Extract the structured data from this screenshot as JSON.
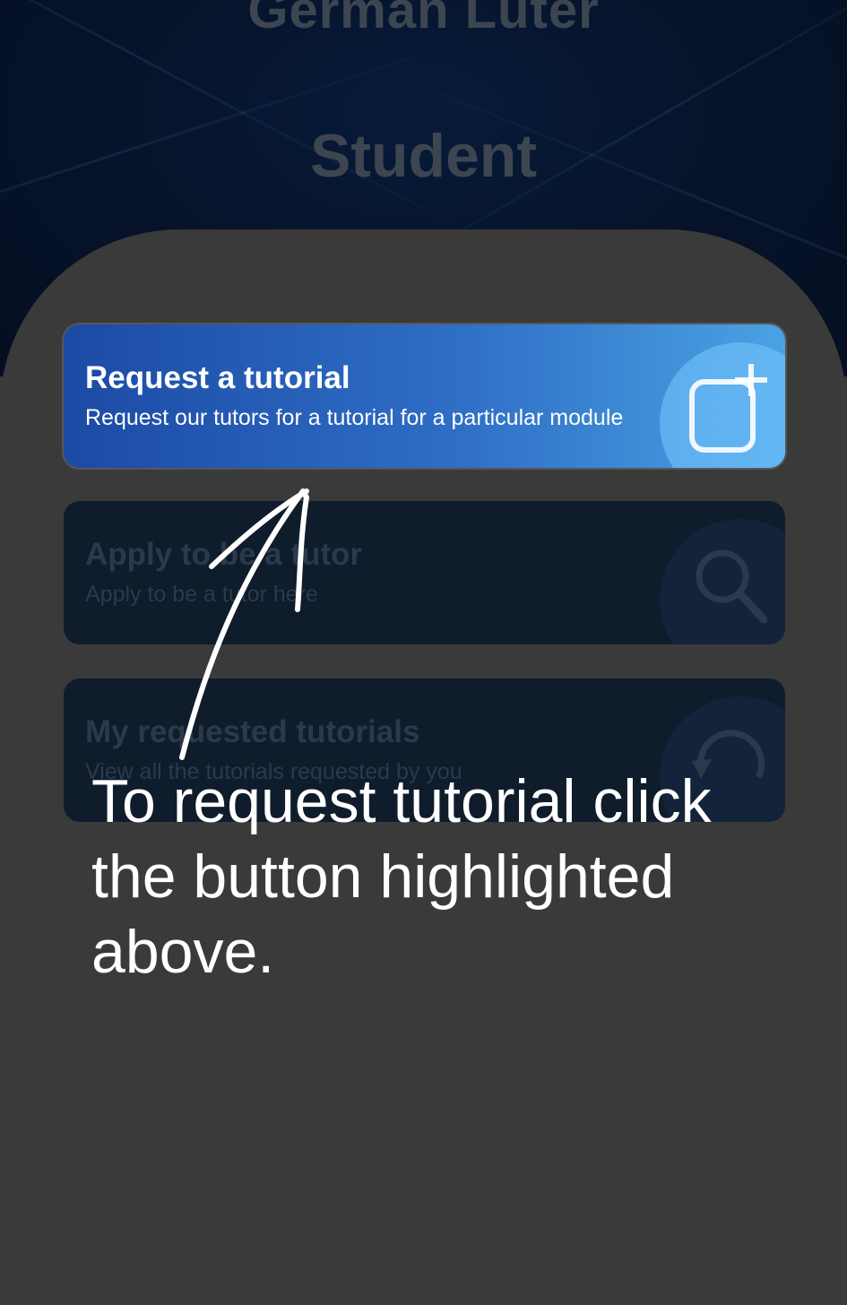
{
  "header": {
    "app_name": "German Luter",
    "role": "Student"
  },
  "cards": [
    {
      "title": "Request a tutorial",
      "subtitle": "Request our tutors for a tutorial for a particular module",
      "icon": "add-square-icon",
      "highlighted": true
    },
    {
      "title": "Apply to be a tutor",
      "subtitle": "Apply to be a tutor here",
      "icon": "search-icon",
      "highlighted": false
    },
    {
      "title": "My requested tutorials",
      "subtitle": "View all the tutorials requested by you",
      "icon": "refresh-icon",
      "highlighted": false
    }
  ],
  "overlay": {
    "caption": "To request tutorial click the button highlighted above.",
    "arrow_icon": "hand-drawn-arrow-icon"
  },
  "colors": {
    "header_bg": "#0a1f44",
    "sheet_bg": "#3a3a3a",
    "card_active_start": "#1c4aa5",
    "card_active_end": "#4aa2e3",
    "card_dim": "#0f1c2c"
  }
}
